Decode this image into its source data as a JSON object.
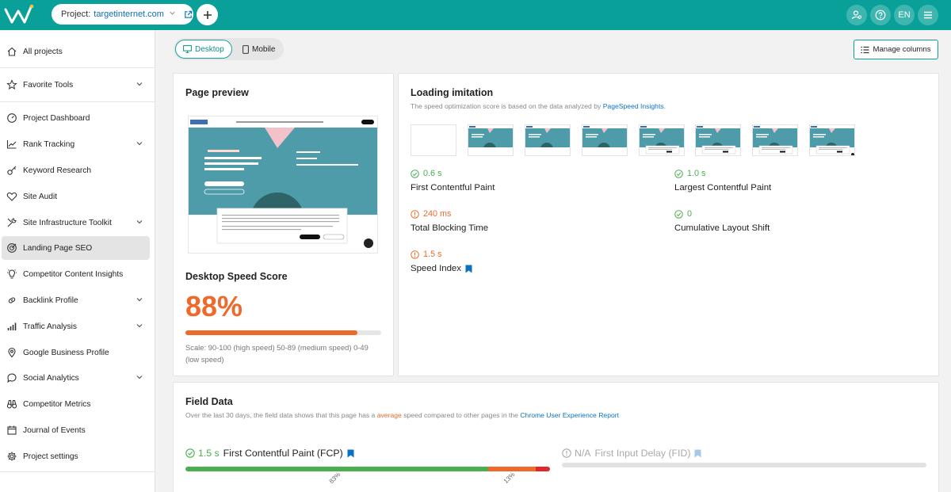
{
  "topbar": {
    "project_label": "Project:",
    "project_value": "targetinternet.com",
    "language": "EN"
  },
  "sidebar": {
    "items": [
      {
        "label": "All projects",
        "icon": "home-icon"
      },
      {
        "label": "Favorite Tools",
        "icon": "star-icon",
        "chevron": true
      },
      {
        "label": "Project Dashboard",
        "icon": "dashboard-icon"
      },
      {
        "label": "Rank Tracking",
        "icon": "line-chart-icon",
        "chevron": true
      },
      {
        "label": "Keyword Research",
        "icon": "key-icon"
      },
      {
        "label": "Site Audit",
        "icon": "heart-pulse-icon"
      },
      {
        "label": "Site Infrastructure Toolkit",
        "icon": "tools-icon",
        "chevron": true
      },
      {
        "label": "Landing Page SEO",
        "icon": "target-icon",
        "active": true
      },
      {
        "label": "Competitor Content Insights",
        "icon": "bulb-icon"
      },
      {
        "label": "Backlink Profile",
        "icon": "link-icon",
        "chevron": true
      },
      {
        "label": "Traffic Analysis",
        "icon": "bar-chart-icon",
        "chevron": true
      },
      {
        "label": "Google Business Profile",
        "icon": "location-pin-icon"
      },
      {
        "label": "Social Analytics",
        "icon": "chat-bubble-icon",
        "chevron": true
      },
      {
        "label": "Competitor Metrics",
        "icon": "binoculars-icon"
      },
      {
        "label": "Journal of Events",
        "icon": "calendar-icon"
      },
      {
        "label": "Project settings",
        "icon": "gear-icon"
      }
    ]
  },
  "toolbar": {
    "desktop_label": "Desktop",
    "mobile_label": "Mobile",
    "manage_columns_label": "Manage columns"
  },
  "preview_card": {
    "title": "Page preview",
    "score_title": "Desktop Speed Score",
    "score_value": "88%",
    "score_fraction": 0.88,
    "scale_text": "Scale: 90-100 (high speed) 50-89 (medium speed) 0-49 (low speed)"
  },
  "loading_card": {
    "title": "Loading imitation",
    "subtitle_prefix": "The speed optimization score is based on the data analyzed by",
    "subtitle_link": "PageSpeed Insights",
    "subtitle_suffix": ".",
    "metrics": [
      {
        "value": "0.6 s",
        "name": "First Contentful Paint",
        "status": "good"
      },
      {
        "value": "1.0 s",
        "name": "Largest Contentful Paint",
        "status": "good"
      },
      {
        "value": "240 ms",
        "name": "Total Blocking Time",
        "status": "warn"
      },
      {
        "value": "0",
        "name": "Cumulative Layout Shift",
        "status": "good"
      },
      {
        "value": "1.5 s",
        "name": "Speed Index",
        "status": "warn",
        "bookmark": true
      }
    ]
  },
  "field_card": {
    "title": "Field Data",
    "desc_prefix": "Over the last 30 days, the field data shows that this page has a",
    "desc_highlight": "average",
    "desc_middle": "speed compared to other pages in the",
    "desc_link": "Chrome User Experience Report",
    "fcp_value": "1.5 s",
    "fcp_label": "First Contentful Paint (FCP)",
    "fcp_distribution": [
      83,
      13,
      4
    ],
    "fcp_pct_labels": [
      "83%",
      "13%"
    ],
    "fid_value": "N/A",
    "fid_label": "First Input Delay (FID)"
  },
  "colors": {
    "brand": "#0aa09a",
    "good": "#4bae4f",
    "warn": "#ef6a2a",
    "bad": "#e0282e",
    "link": "#0a72c2"
  }
}
